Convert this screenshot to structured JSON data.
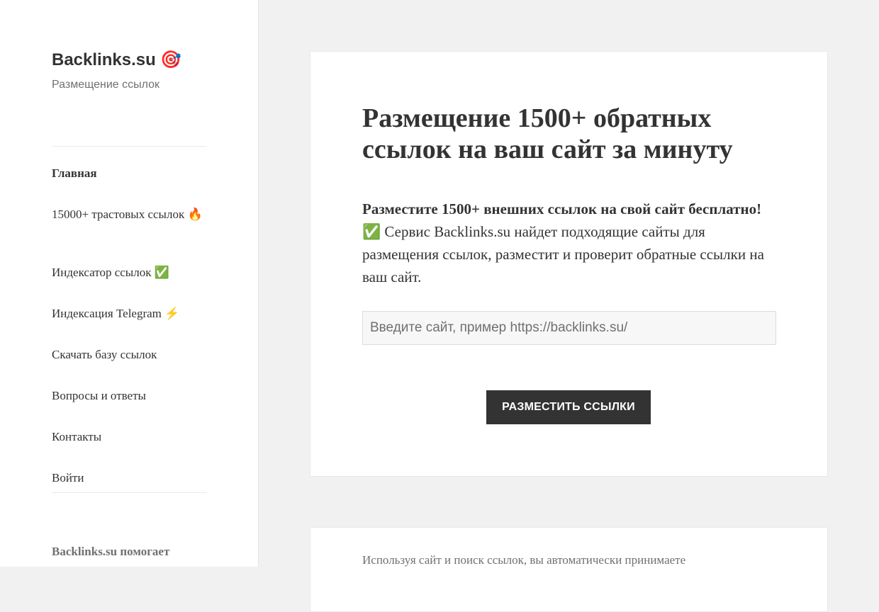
{
  "site": {
    "title": "Backlinks.su",
    "title_icon": "🎯",
    "description": "Размещение ссылок"
  },
  "menu": {
    "items": [
      {
        "label": "Главная",
        "active": true
      },
      {
        "label": "15000+ трастовых ссылок 🔥"
      },
      {
        "label": "Индексатор ссылок ✅"
      },
      {
        "label": "Индексация Telegram ⚡"
      },
      {
        "label": "Скачать базу ссылок"
      },
      {
        "label": "Вопросы и ответы"
      },
      {
        "label": "Контакты"
      },
      {
        "label": "Войти"
      }
    ]
  },
  "widget": {
    "title": "Backlinks.su помогает"
  },
  "main": {
    "title": "Размещение 1500+ обратных ссылок на ваш сайт за минуту",
    "intro_bold": "Разместите 1500+ внешних ссылок на свой сайт бесплатно!",
    "intro_check": "✅",
    "intro_rest": " Сервис Backlinks.su найдет подходящие сайты для размещения ссылок, разместит и проверит обратные ссылки на ваш сайт.",
    "input_value": "",
    "input_placeholder": "Введите сайт, пример https://backlinks.su/",
    "submit_label": "РАЗМЕСТИТЬ ССЫЛКИ"
  },
  "notice": {
    "text": "Используя сайт и поиск ссылок, вы автоматически принимаете"
  },
  "colors": {
    "page_bg": "#f1f1f1",
    "text": "#333333",
    "muted": "#707070",
    "button_bg": "#333333",
    "button_text": "#ffffff"
  }
}
